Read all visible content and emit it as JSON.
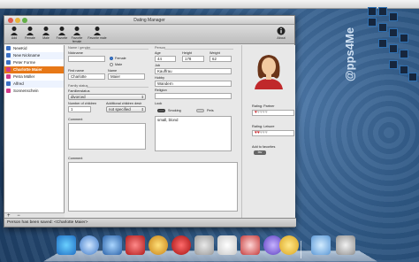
{
  "window": {
    "title": "Dating Manager"
  },
  "toolbar": {
    "buttons": [
      {
        "label": "Add"
      },
      {
        "label": "Female"
      },
      {
        "label": "Male"
      },
      {
        "label": "Favorite"
      },
      {
        "label": "Favorite female"
      },
      {
        "label": "Favorite male"
      }
    ],
    "about_label": "About"
  },
  "sidebar": {
    "items": [
      {
        "label": "NewKid"
      },
      {
        "label": "New Nickname"
      },
      {
        "label": "Peter Forme"
      },
      {
        "label": "Charlotte Maier"
      },
      {
        "label": "Petra Müller"
      },
      {
        "label": "Alfred"
      },
      {
        "label": "Sonnenschein"
      }
    ],
    "add": "+",
    "remove": "−"
  },
  "form": {
    "name_gender_group": "Name / gender",
    "nickname_label": "Nickname",
    "nickname": "",
    "female_label": "Female",
    "male_label": "Male",
    "firstname_label": "First name",
    "firstname": "Charlotte",
    "name_label": "Name",
    "name": "Maier",
    "family_group": "Family status",
    "familienstatus_label": "Familienstatus",
    "familienstatus": "divorced",
    "children_label": "Number of children",
    "children": "1",
    "add_children_label": "Additional children desir",
    "add_children": "not specified",
    "comment_label": "Comment",
    "comment2_label": "Comment",
    "person_group": "Person",
    "age_label": "Age",
    "age": "44",
    "height_label": "Height",
    "height": "178",
    "weight_label": "Weight",
    "weight": "62",
    "job_label": "Job",
    "job": "Kauffrau",
    "hobby_label": "Hobby",
    "hobby": "Wandern",
    "religion_label": "Religion",
    "religion": "",
    "look_label": "Look",
    "smoking_label": "Smoking",
    "pets_label": "Pets",
    "look_value": "small, blond"
  },
  "rating": {
    "partner_label": "Rating: Partner",
    "partner_stars": 1,
    "leisure_label": "Rating: Leisure",
    "leisure_stars": 2,
    "max_stars": 5,
    "favorites_label": "Add to favorites",
    "favorites_button": "fav"
  },
  "status": {
    "text": "Person has been saved: <Charlotte Maier>"
  },
  "logo": {
    "text": "@pps4Me"
  },
  "colors": {
    "selection": "#e77817",
    "star": "#c8272d"
  }
}
